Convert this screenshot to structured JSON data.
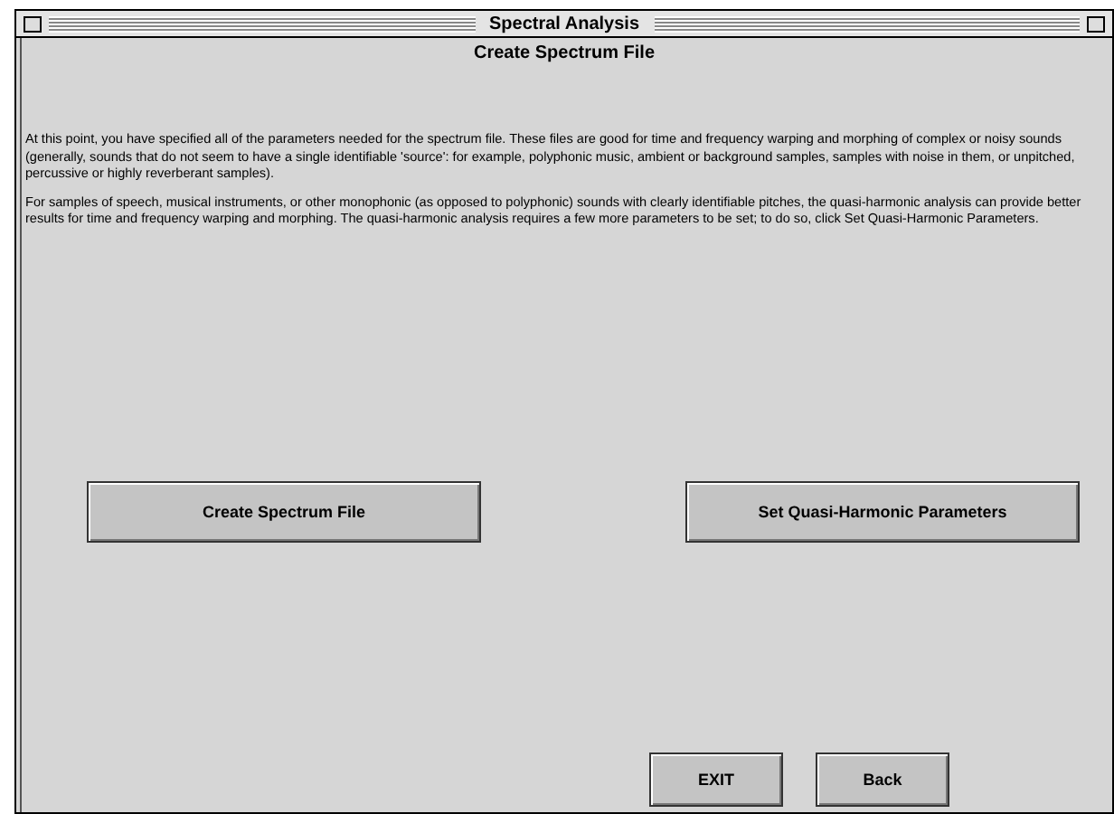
{
  "window": {
    "title": "Spectral Analysis"
  },
  "heading": "Create Spectrum File",
  "paragraphs": [
    "At this point, you have specified all of the parameters needed for the spectrum file. These files are good for time and frequency warping and morphing of complex or noisy sounds\n(generally, sounds that do not seem to have a single identifiable 'source': for example, polyphonic music, ambient or background samples, samples with noise in them, or unpitched,\npercussive or highly reverberant samples).",
    "For samples of speech, musical instruments, or other monophonic (as opposed to polyphonic) sounds with clearly identifiable pitches, the quasi-harmonic analysis can provide better\nresults for time and frequency warping and morphing. The quasi-harmonic analysis requires a few more parameters to be set; to do so, click Set Quasi-Harmonic Parameters."
  ],
  "main_buttons": [
    "Create Spectrum File",
    "Set Quasi-Harmonic Parameters"
  ],
  "bottom_buttons": [
    "EXIT",
    "Back"
  ]
}
